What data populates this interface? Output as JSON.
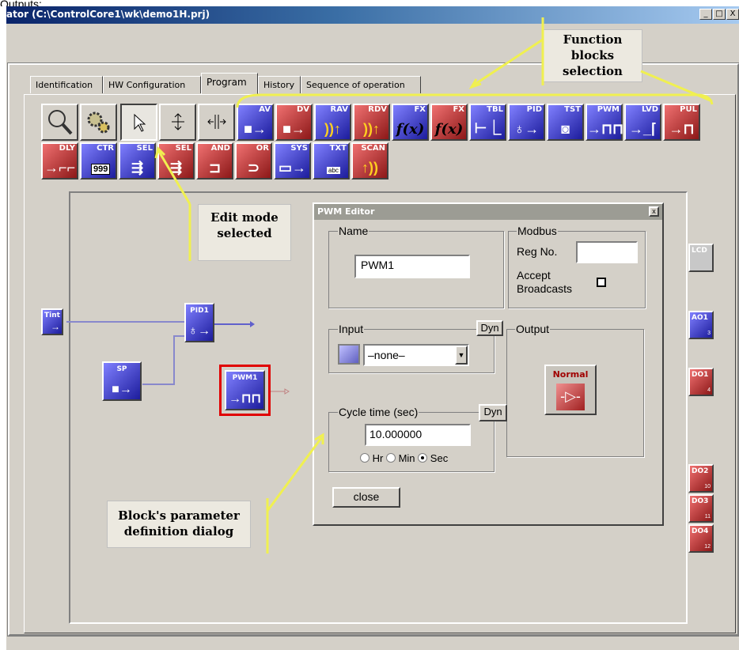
{
  "top_caption": "Outputs:",
  "window": {
    "title": "ator (C:\\ControlCore1\\wk\\demo1H.prj)",
    "minimize": "_",
    "maximize": "□",
    "close": "X"
  },
  "tabs": [
    {
      "label": "Identification"
    },
    {
      "label": "HW Configuration"
    },
    {
      "label": "Program"
    },
    {
      "label": "History"
    },
    {
      "label": "Sequence of operation"
    }
  ],
  "toolbar": [
    {
      "label": "",
      "icon": "magnifier-icon"
    },
    {
      "label": "",
      "icon": "gears-icon"
    },
    {
      "label": "",
      "icon": "arrow-pointer-icon"
    },
    {
      "label": "",
      "icon": "vertical-resize-icon"
    },
    {
      "label": "",
      "icon": "horizontal-resize-icon"
    },
    {
      "label": "AV",
      "icon": "analog-value-icon"
    },
    {
      "label": "DV",
      "icon": "digital-value-icon"
    },
    {
      "label": "RAV",
      "icon": "remote-analog-icon"
    },
    {
      "label": "RDV",
      "icon": "remote-digital-icon"
    },
    {
      "label": "FX",
      "icon": "function-blue-icon"
    },
    {
      "label": "FX",
      "icon": "function-red-icon"
    },
    {
      "label": "TBL",
      "icon": "table-icon"
    },
    {
      "label": "PID",
      "icon": "pid-icon"
    },
    {
      "label": "TST",
      "icon": "test-icon"
    },
    {
      "label": "PWM",
      "icon": "pwm-icon"
    },
    {
      "label": "LVD",
      "icon": "lvd-icon"
    },
    {
      "label": "PUL",
      "icon": "pulse-icon"
    },
    {
      "label": "DLY",
      "icon": "delay-icon"
    },
    {
      "label": "CTR",
      "icon": "counter-icon"
    },
    {
      "label": "SEL",
      "icon": "select-blue-icon"
    },
    {
      "label": "SEL",
      "icon": "select-red-icon"
    },
    {
      "label": "AND",
      "icon": "and-gate-icon"
    },
    {
      "label": "OR",
      "icon": "or-gate-icon"
    },
    {
      "label": "SYS",
      "icon": "system-icon"
    },
    {
      "label": "TXT",
      "icon": "text-icon"
    },
    {
      "label": "SCAN",
      "icon": "scan-icon"
    }
  ],
  "counter_display": "999",
  "text_display": "abc",
  "callouts": {
    "function_blocks": "Function blocks selection",
    "edit_mode": "Edit mode selected",
    "param_dialog": "Block's parameter definition dialog"
  },
  "canvas": {
    "blocks": {
      "tint": "Tint",
      "pid1": "PID1",
      "sp": "SP",
      "pwm1": "PWM1"
    },
    "outputs": [
      {
        "label": "LCD",
        "num": ""
      },
      {
        "label": "AO1",
        "num": "3"
      },
      {
        "label": "DO1",
        "num": "4"
      },
      {
        "label": "DO2",
        "num": "10"
      },
      {
        "label": "DO3",
        "num": "11"
      },
      {
        "label": "DO4",
        "num": "12"
      }
    ]
  },
  "pwm_editor": {
    "title": "PWM Editor",
    "close_x": "x",
    "name_group": "Name",
    "name_value": "PWM1",
    "modbus_group": "Modbus",
    "reg_no_label": "Reg No.",
    "reg_no_value": "",
    "accept_broadcasts": "Accept Broadcasts",
    "input_group": "Input",
    "dyn": "Dyn",
    "input_value": "–none–",
    "output_group": "Output",
    "output_mode": "Normal",
    "cycle_group": "Cycle time (sec)",
    "cycle_value": "10.000000",
    "radios": [
      {
        "label": "Hr",
        "selected": false
      },
      {
        "label": "Min",
        "selected": false
      },
      {
        "label": "Sec",
        "selected": true
      }
    ],
    "close_button": "close"
  },
  "colors": {
    "accent_blue": "#2a2aa8",
    "accent_red": "#a82020",
    "callout_line": "#f0f050"
  }
}
